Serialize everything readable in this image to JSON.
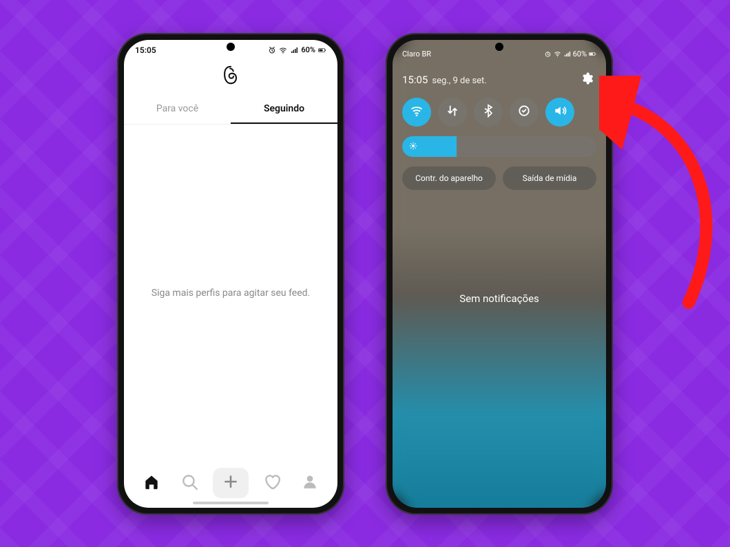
{
  "colors": {
    "background": "#8a2be2",
    "accent_blue": "#29b6e6",
    "arrow": "#ff1a1a"
  },
  "phone_a": {
    "status": {
      "time": "15:05",
      "battery_text": "60%"
    },
    "app_logo": "threads-logo",
    "tabs": [
      {
        "label": "Para você",
        "active": false
      },
      {
        "label": "Seguindo",
        "active": true
      }
    ],
    "empty_message": "Siga mais perfis para agitar seu feed.",
    "nav": {
      "home": "home-icon",
      "search": "search-icon",
      "compose": "plus-icon",
      "activity": "heart-icon",
      "profile": "profile-icon"
    }
  },
  "phone_b": {
    "status": {
      "carrier": "Claro BR",
      "battery_text": "60%"
    },
    "datetime": {
      "time": "15:05",
      "date": "seg., 9 de set."
    },
    "settings_icon": "gear-icon",
    "quick_settings": [
      {
        "name": "wifi-icon",
        "on": true
      },
      {
        "name": "data-icon",
        "on": false
      },
      {
        "name": "bluetooth-icon",
        "on": false
      },
      {
        "name": "sync-icon",
        "on": false
      },
      {
        "name": "sound-icon",
        "on": true
      }
    ],
    "brightness_percent": 28,
    "chips": [
      {
        "label": "Contr. do aparelho"
      },
      {
        "label": "Saída de mídia"
      }
    ],
    "no_notifications": "Sem notificações"
  }
}
